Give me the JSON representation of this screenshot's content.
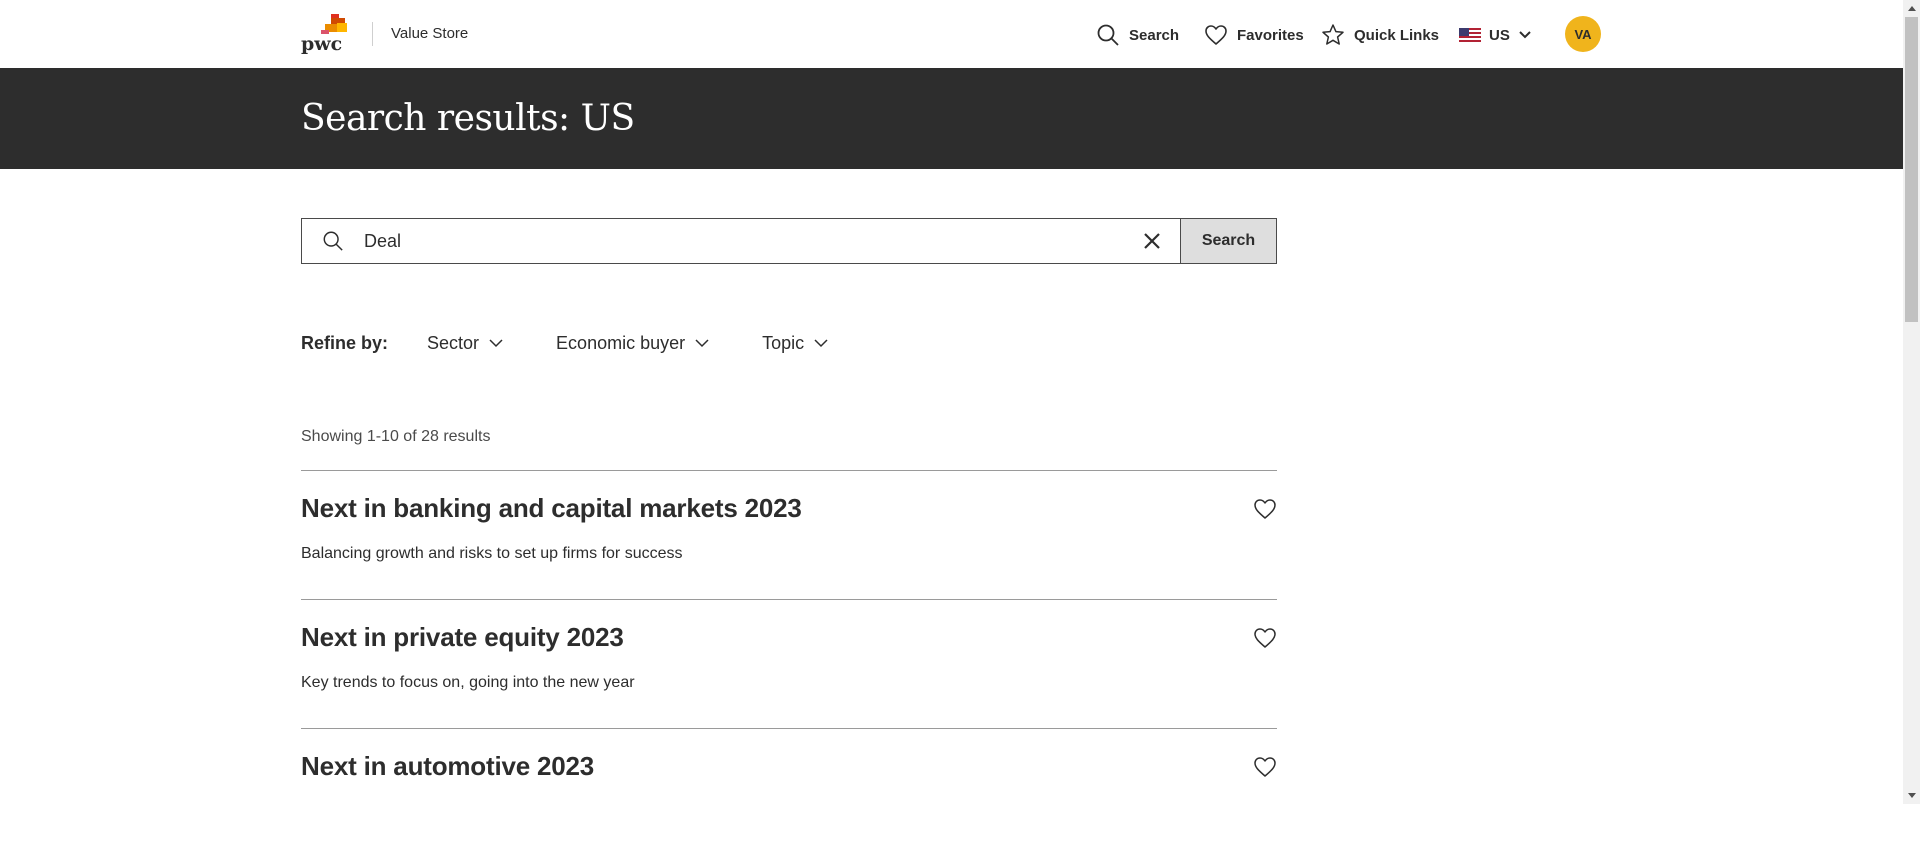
{
  "header": {
    "logo_text": "pwc",
    "app_name": "Value Store",
    "nav": {
      "search_label": "Search",
      "favorites_label": "Favorites",
      "quick_links_label": "Quick Links",
      "region_label": "US"
    },
    "avatar_initials": "VA",
    "avatar_color": "#f0b41c"
  },
  "hero": {
    "title": "Search results: US",
    "background": "#2d2d2d"
  },
  "search": {
    "value": "Deal",
    "button_label": "Search"
  },
  "refine": {
    "label": "Refine by:",
    "filters": [
      "Sector",
      "Economic buyer",
      "Topic"
    ]
  },
  "results": {
    "count_text": "Showing 1-10 of 28 results",
    "items": [
      {
        "title": "Next in banking and capital markets 2023",
        "description": "Balancing growth and risks to set up firms for success"
      },
      {
        "title": "Next in private equity 2023",
        "description": "Key trends to focus on, going into the new year"
      },
      {
        "title": "Next in automotive 2023",
        "description": ""
      }
    ]
  },
  "icons": {
    "search": "search-icon",
    "favorites": "heart-icon",
    "quick_links": "star-icon",
    "region_flag": "us-flag-icon",
    "dropdown": "chevron-down-icon",
    "clear": "close-icon"
  }
}
